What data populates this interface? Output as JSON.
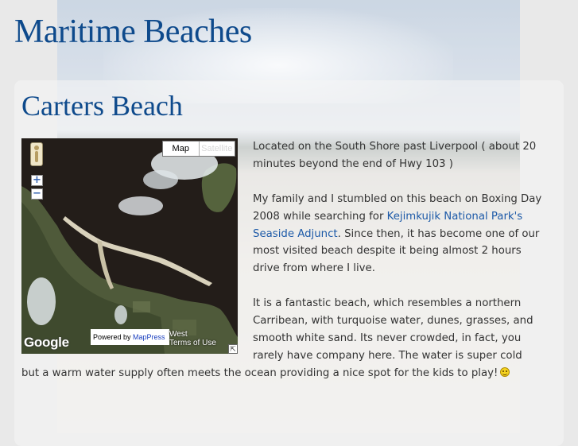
{
  "site": {
    "title": "Maritime Beaches"
  },
  "page": {
    "heading": "Carters Beach"
  },
  "map": {
    "type_buttons": [
      "Map",
      "Satellite"
    ],
    "zoom_in": "+",
    "zoom_out": "−",
    "logo": "Google",
    "powered_prefix": "Powered by ",
    "powered_link": "MapPress",
    "attribution": "West\nTerms of Use",
    "corner": "⇱"
  },
  "article": {
    "p1": "Located on the South Shore past Liverpool ( about 20 minutes beyond the end of Hwy 103 )",
    "p2_before": "My family and I stumbled on this beach on Boxing Day 2008 while searching for ",
    "p2_link": "Kejimkujik National Park's Seaside Adjunct",
    "p2_after": ". Since then, it has become one of our most visited beach despite it being almost 2 hours drive from where I live.",
    "p3": "It is a fantastic beach, which resembles a northern Carribean, with turquoise water, dunes, grasses, and smooth white sand. Its never crowded, in fact, you rarely have company here. The water is super cold but a warm water supply often meets the ocean providing a nice spot for the kids to play!",
    "emoticon": "smiley-face-icon"
  },
  "colors": {
    "title": "#0e4a8c",
    "link": "#1d5aa8",
    "text": "#333333"
  }
}
